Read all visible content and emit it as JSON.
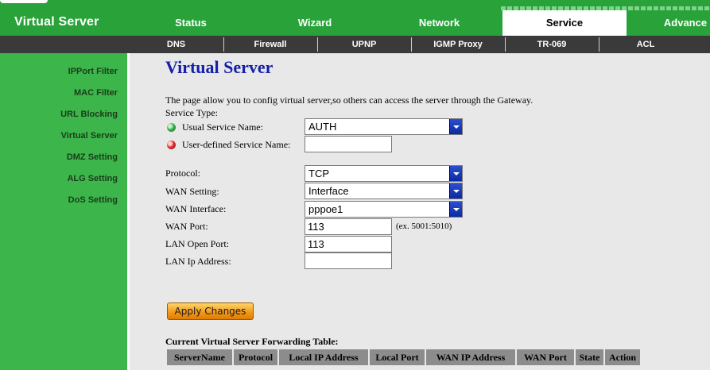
{
  "header": {
    "title": "Virtual Server",
    "tabs": [
      {
        "label": "Status",
        "active": false
      },
      {
        "label": "Wizard",
        "active": false
      },
      {
        "label": "Network",
        "active": false
      },
      {
        "label": "Service",
        "active": true
      },
      {
        "label": "Advance",
        "active": false
      }
    ]
  },
  "subnav": {
    "tabs": [
      "DNS",
      "Firewall",
      "UPNP",
      "IGMP Proxy",
      "TR-069",
      "ACL"
    ]
  },
  "sidebar": {
    "items": [
      {
        "label": "IPPort Filter"
      },
      {
        "label": "MAC Filter"
      },
      {
        "label": "URL Blocking"
      },
      {
        "label": "Virtual Server"
      },
      {
        "label": "DMZ Setting"
      },
      {
        "label": "ALG Setting"
      },
      {
        "label": "DoS Setting"
      }
    ]
  },
  "main": {
    "title": "Virtual Server",
    "description": "The page allow you to config virtual server,so others can access the server through the Gateway.",
    "service_type_label": "Service Type:",
    "usual_service_label": "Usual Service Name:",
    "usual_service_value": "AUTH",
    "user_defined_label": "User-defined Service Name:",
    "user_defined_value": "",
    "protocol_label": "Protocol:",
    "protocol_value": "TCP",
    "wan_setting_label": "WAN Setting:",
    "wan_setting_value": "Interface",
    "wan_interface_label": "WAN Interface:",
    "wan_interface_value": "pppoe1",
    "wan_port_label": "WAN Port:",
    "wan_port_value": "113",
    "wan_port_hint": "(ex. 5001:5010)",
    "lan_open_port_label": "LAN Open Port:",
    "lan_open_port_value": "113",
    "lan_ip_label": "LAN Ip Address:",
    "lan_ip_value": "",
    "apply_label": "Apply Changes",
    "table_title": "Current Virtual Server Forwarding Table:",
    "table_headers": [
      "ServerName",
      "Protocol",
      "Local IP Address",
      "Local Port",
      "WAN IP Address",
      "WAN Port",
      "State",
      "Action"
    ]
  },
  "colors": {
    "brand_green": "#2aa23a",
    "sidebar_green": "#3cb54a",
    "title_blue": "#1420a8",
    "button_orange": "#f39a1a"
  }
}
